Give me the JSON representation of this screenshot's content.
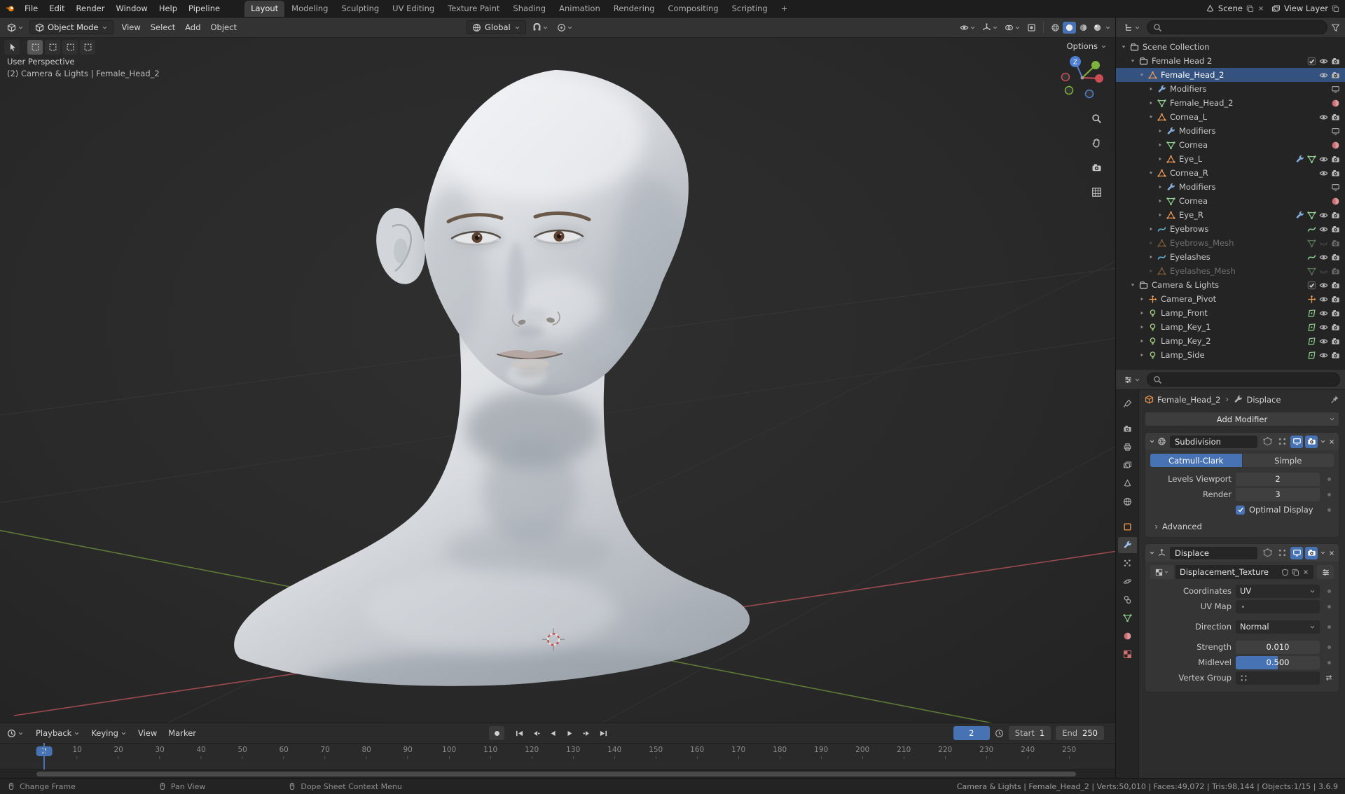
{
  "topbar": {
    "menus": [
      "File",
      "Edit",
      "Render",
      "Window",
      "Help",
      "Pipeline"
    ],
    "workspaces": [
      "Layout",
      "Modeling",
      "Sculpting",
      "UV Editing",
      "Texture Paint",
      "Shading",
      "Animation",
      "Rendering",
      "Compositing",
      "Scripting"
    ],
    "active_workspace": "Layout",
    "add_workspace_label": "+",
    "scene_label": "Scene",
    "view_layer_label": "View Layer"
  },
  "tool_header": {
    "mode_label": "Object Mode",
    "menus": [
      "View",
      "Select",
      "Add",
      "Object"
    ],
    "orientation_label": "Global",
    "shading_modes": [
      "wireframe",
      "solid",
      "material-preview",
      "rendered"
    ],
    "active_shading": "solid"
  },
  "viewport": {
    "perspective_label": "User Perspective",
    "context_label": "(2) Camera & Lights | Female_Head_2",
    "gizmo_z_label": "Z",
    "options_label": "Options",
    "select_tools": [
      "tweak-select",
      "box-select-new",
      "box-select-extend",
      "box-select-subtract",
      "box-select-intersect"
    ],
    "nav_buttons": [
      "zoom",
      "pan-hand",
      "camera-view",
      "toggle-ortho"
    ]
  },
  "outliner": {
    "rows": [
      {
        "label": "Scene Collection",
        "indent": 0,
        "exp": "open",
        "icon": "collection",
        "eye": false,
        "cam": false
      },
      {
        "label": "Female Head 2",
        "indent": 1,
        "exp": "open",
        "icon": "collection",
        "checkbox": true,
        "eye": true,
        "cam": true
      },
      {
        "label": "Female_Head_2",
        "indent": 2,
        "exp": "open",
        "icon": "mesh-object",
        "selected": true,
        "eye": true,
        "cam": true
      },
      {
        "label": "Modifiers",
        "indent": 3,
        "exp": "closed",
        "icon": "wrench",
        "trailing": [
          "monitor"
        ],
        "eye": false,
        "cam": false
      },
      {
        "label": "Female_Head_2",
        "indent": 3,
        "exp": "closed",
        "icon": "mesh-data",
        "trailing": [
          "material"
        ],
        "eye": false,
        "cam": false
      },
      {
        "label": "Cornea_L",
        "indent": 3,
        "exp": "open",
        "icon": "mesh-object",
        "eye": true,
        "cam": true
      },
      {
        "label": "Modifiers",
        "indent": 4,
        "exp": "closed",
        "icon": "wrench",
        "trailing": [
          "monitor"
        ],
        "eye": false,
        "cam": false
      },
      {
        "label": "Cornea",
        "indent": 4,
        "exp": "closed",
        "icon": "mesh-data",
        "trailing": [
          "material"
        ],
        "eye": false,
        "cam": false
      },
      {
        "label": "Eye_L",
        "indent": 4,
        "exp": "closed",
        "icon": "mesh-object",
        "trailing": [
          "wrench",
          "mesh-data"
        ],
        "eye": true,
        "cam": true
      },
      {
        "label": "Cornea_R",
        "indent": 3,
        "exp": "open",
        "icon": "mesh-object",
        "eye": true,
        "cam": true
      },
      {
        "label": "Modifiers",
        "indent": 4,
        "exp": "closed",
        "icon": "wrench",
        "trailing": [
          "monitor"
        ],
        "eye": false,
        "cam": false
      },
      {
        "label": "Cornea",
        "indent": 4,
        "exp": "closed",
        "icon": "mesh-data",
        "trailing": [
          "material"
        ],
        "eye": false,
        "cam": false
      },
      {
        "label": "Eye_R",
        "indent": 4,
        "exp": "closed",
        "icon": "mesh-object",
        "trailing": [
          "wrench",
          "mesh-data"
        ],
        "eye": true,
        "cam": true
      },
      {
        "label": "Eyebrows",
        "indent": 3,
        "exp": "closed",
        "icon": "curve-object",
        "trailing": [
          "curve-data"
        ],
        "eye": true,
        "cam": true
      },
      {
        "label": "Eyebrows_Mesh",
        "indent": 3,
        "exp": "closed",
        "icon": "mesh-object",
        "trailing": [
          "mesh-data"
        ],
        "dim": true,
        "eye": "closed",
        "cam": true
      },
      {
        "label": "Eyelashes",
        "indent": 3,
        "exp": "closed",
        "icon": "curve-object",
        "trailing": [
          "curve-data"
        ],
        "eye": true,
        "cam": true
      },
      {
        "label": "Eyelashes_Mesh",
        "indent": 3,
        "exp": "closed",
        "icon": "mesh-object",
        "trailing": [
          "mesh-data"
        ],
        "dim": true,
        "eye": "closed",
        "cam": true
      },
      {
        "label": "Camera & Lights",
        "indent": 1,
        "exp": "open",
        "icon": "collection",
        "checkbox": true,
        "eye": true,
        "cam": true
      },
      {
        "label": "Camera_Pivot",
        "indent": 2,
        "exp": "closed",
        "icon": "empty",
        "trailing": [
          "empty"
        ],
        "eye": true,
        "cam": true
      },
      {
        "label": "Lamp_Front",
        "indent": 2,
        "exp": "closed",
        "icon": "light-object",
        "trailing": [
          "light-data"
        ],
        "eye": true,
        "cam": true
      },
      {
        "label": "Lamp_Key_1",
        "indent": 2,
        "exp": "closed",
        "icon": "light-object",
        "trailing": [
          "light-data"
        ],
        "eye": true,
        "cam": true
      },
      {
        "label": "Lamp_Key_2",
        "indent": 2,
        "exp": "closed",
        "icon": "light-object",
        "trailing": [
          "light-data"
        ],
        "eye": true,
        "cam": true
      },
      {
        "label": "Lamp_Side",
        "indent": 2,
        "exp": "closed",
        "icon": "light-object",
        "trailing": [
          "light-data"
        ],
        "eye": true,
        "cam": true
      }
    ]
  },
  "properties": {
    "breadcrumb": {
      "object": "Female_Head_2",
      "modifier": "Displace"
    },
    "add_modifier_label": "Add Modifier",
    "active_tab": "modifiers",
    "tabs": [
      {
        "id": "tool",
        "icon": "tool"
      },
      {
        "id": "render",
        "icon": "camera"
      },
      {
        "id": "output",
        "icon": "printer"
      },
      {
        "id": "view-layer",
        "icon": "images"
      },
      {
        "id": "scene",
        "icon": "cone"
      },
      {
        "id": "world",
        "icon": "globe"
      },
      {
        "id": "object",
        "icon": "square"
      },
      {
        "id": "modifiers",
        "icon": "wrench"
      },
      {
        "id": "particles",
        "icon": "particles"
      },
      {
        "id": "physics",
        "icon": "physics"
      },
      {
        "id": "constraints",
        "icon": "constraints"
      },
      {
        "id": "object-data",
        "icon": "mesh-data"
      },
      {
        "id": "material",
        "icon": "material"
      },
      {
        "id": "texture",
        "icon": "checker"
      }
    ],
    "subdivision": {
      "title": "Subdivision",
      "type_options": [
        "Catmull-Clark",
        "Simple"
      ],
      "active_type": "Catmull-Clark",
      "levels_viewport_label": "Levels Viewport",
      "levels_viewport_value": "2",
      "render_label": "Render",
      "render_value": "3",
      "optimal_display_label": "Optimal Display",
      "optimal_display_checked": true,
      "advanced_label": "Advanced"
    },
    "displace": {
      "title": "Displace",
      "texture_name": "Displacement_Texture",
      "rows": [
        {
          "label": "Coordinates",
          "type": "select",
          "value": "UV"
        },
        {
          "label": "UV Map",
          "type": "picker",
          "value": ""
        },
        {
          "label": "Direction",
          "type": "select",
          "value": "Normal",
          "gap": true
        },
        {
          "label": "Strength",
          "type": "number",
          "value": "0.010",
          "gap": true
        },
        {
          "label": "Midlevel",
          "type": "slider",
          "value": "0.500",
          "fill": 0.5
        },
        {
          "label": "Vertex Group",
          "type": "vgroup",
          "value": ""
        }
      ]
    }
  },
  "timeline": {
    "menus": [
      "Playback",
      "Keying",
      "View",
      "Marker"
    ],
    "transport": [
      "jump-start",
      "prev-keyframe",
      "play-reverse",
      "play",
      "next-keyframe",
      "jump-end"
    ],
    "current_frame": "2",
    "start_label": "Start",
    "start_value": "1",
    "end_label": "End",
    "end_value": "250",
    "ticks": [
      10,
      20,
      30,
      40,
      50,
      60,
      70,
      80,
      90,
      100,
      110,
      120,
      130,
      140,
      150,
      160,
      170,
      180,
      190,
      200,
      210,
      220,
      230,
      240,
      250
    ]
  },
  "statusbar": {
    "hints": [
      "Change Frame",
      "Pan View",
      "Dope Sheet Context Menu"
    ],
    "stats": "Camera & Lights | Female_Head_2 | Verts:50,010 | Faces:49,072 | Tris:98,144 | Objects:1/15 | 3.6.9"
  }
}
